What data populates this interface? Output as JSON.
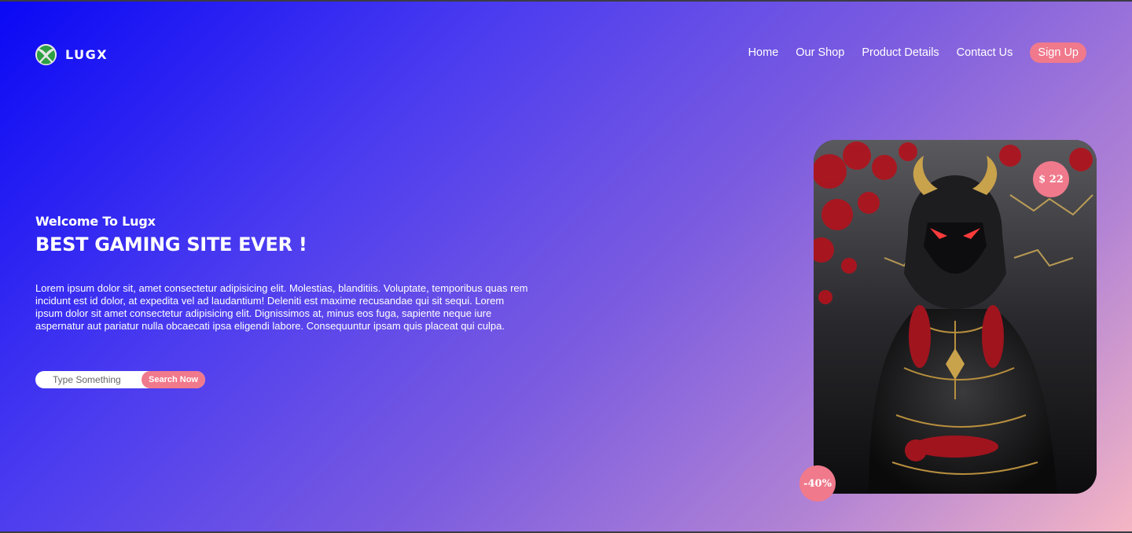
{
  "brand": {
    "name": "LUGX",
    "logo_icon": "xbox-logo-icon"
  },
  "nav": {
    "items": [
      {
        "label": "Home"
      },
      {
        "label": "Our Shop"
      },
      {
        "label": "Product Details"
      },
      {
        "label": "Contact Us"
      }
    ],
    "signup_label": "Sign Up"
  },
  "hero": {
    "welcome": "Welcome To Lugx",
    "headline": "BEST GAMING SITE EVER !",
    "description": "Lorem ipsum dolor sit, amet consectetur adipisicing elit. Molestias, blanditiis. Voluptate, temporibus quas rem incidunt est id dolor, at expedita vel ad laudantium! Deleniti est maxime recusandae qui sit sequi. Lorem ipsum dolor sit amet consectetur adipisicing elit. Dignissimos at, minus eos fuga, sapiente neque iure aspernatur aut pariatur nulla obcaecati ipsa eligendi labore. Consequuntur ipsam quis placeat qui culpa."
  },
  "search": {
    "placeholder": "Type Something",
    "button_label": "Search Now"
  },
  "featured": {
    "price": "$ 22",
    "discount": "-40%"
  },
  "colors": {
    "accent": "#f0798c",
    "gradient_start": "#0a08f5",
    "gradient_end": "#f5b6c4"
  }
}
